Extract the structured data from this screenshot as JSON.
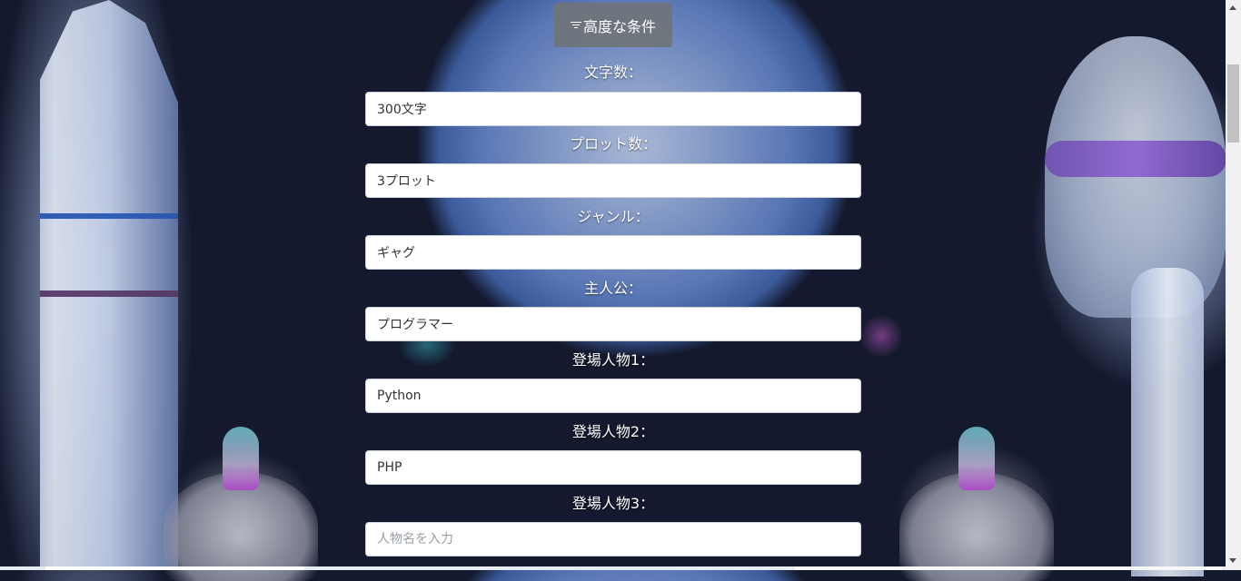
{
  "advanced_button": {
    "label": "高度な条件",
    "icon": "filter-icon"
  },
  "fields": [
    {
      "label": "文字数：",
      "value": "300文字",
      "placeholder": ""
    },
    {
      "label": "プロット数：",
      "value": "3プロット",
      "placeholder": ""
    },
    {
      "label": "ジャンル：",
      "value": "ギャグ",
      "placeholder": ""
    },
    {
      "label": "主人公：",
      "value": "プログラマー",
      "placeholder": ""
    },
    {
      "label": "登場人物1：",
      "value": "Python",
      "placeholder": ""
    },
    {
      "label": "登場人物2：",
      "value": "PHP",
      "placeholder": ""
    },
    {
      "label": "登場人物3：",
      "value": "",
      "placeholder": "人物名を入力"
    }
  ],
  "colors": {
    "background": "#14192e",
    "button": "#707478",
    "label_text": "#ffffff",
    "input_bg": "#ffffff"
  }
}
